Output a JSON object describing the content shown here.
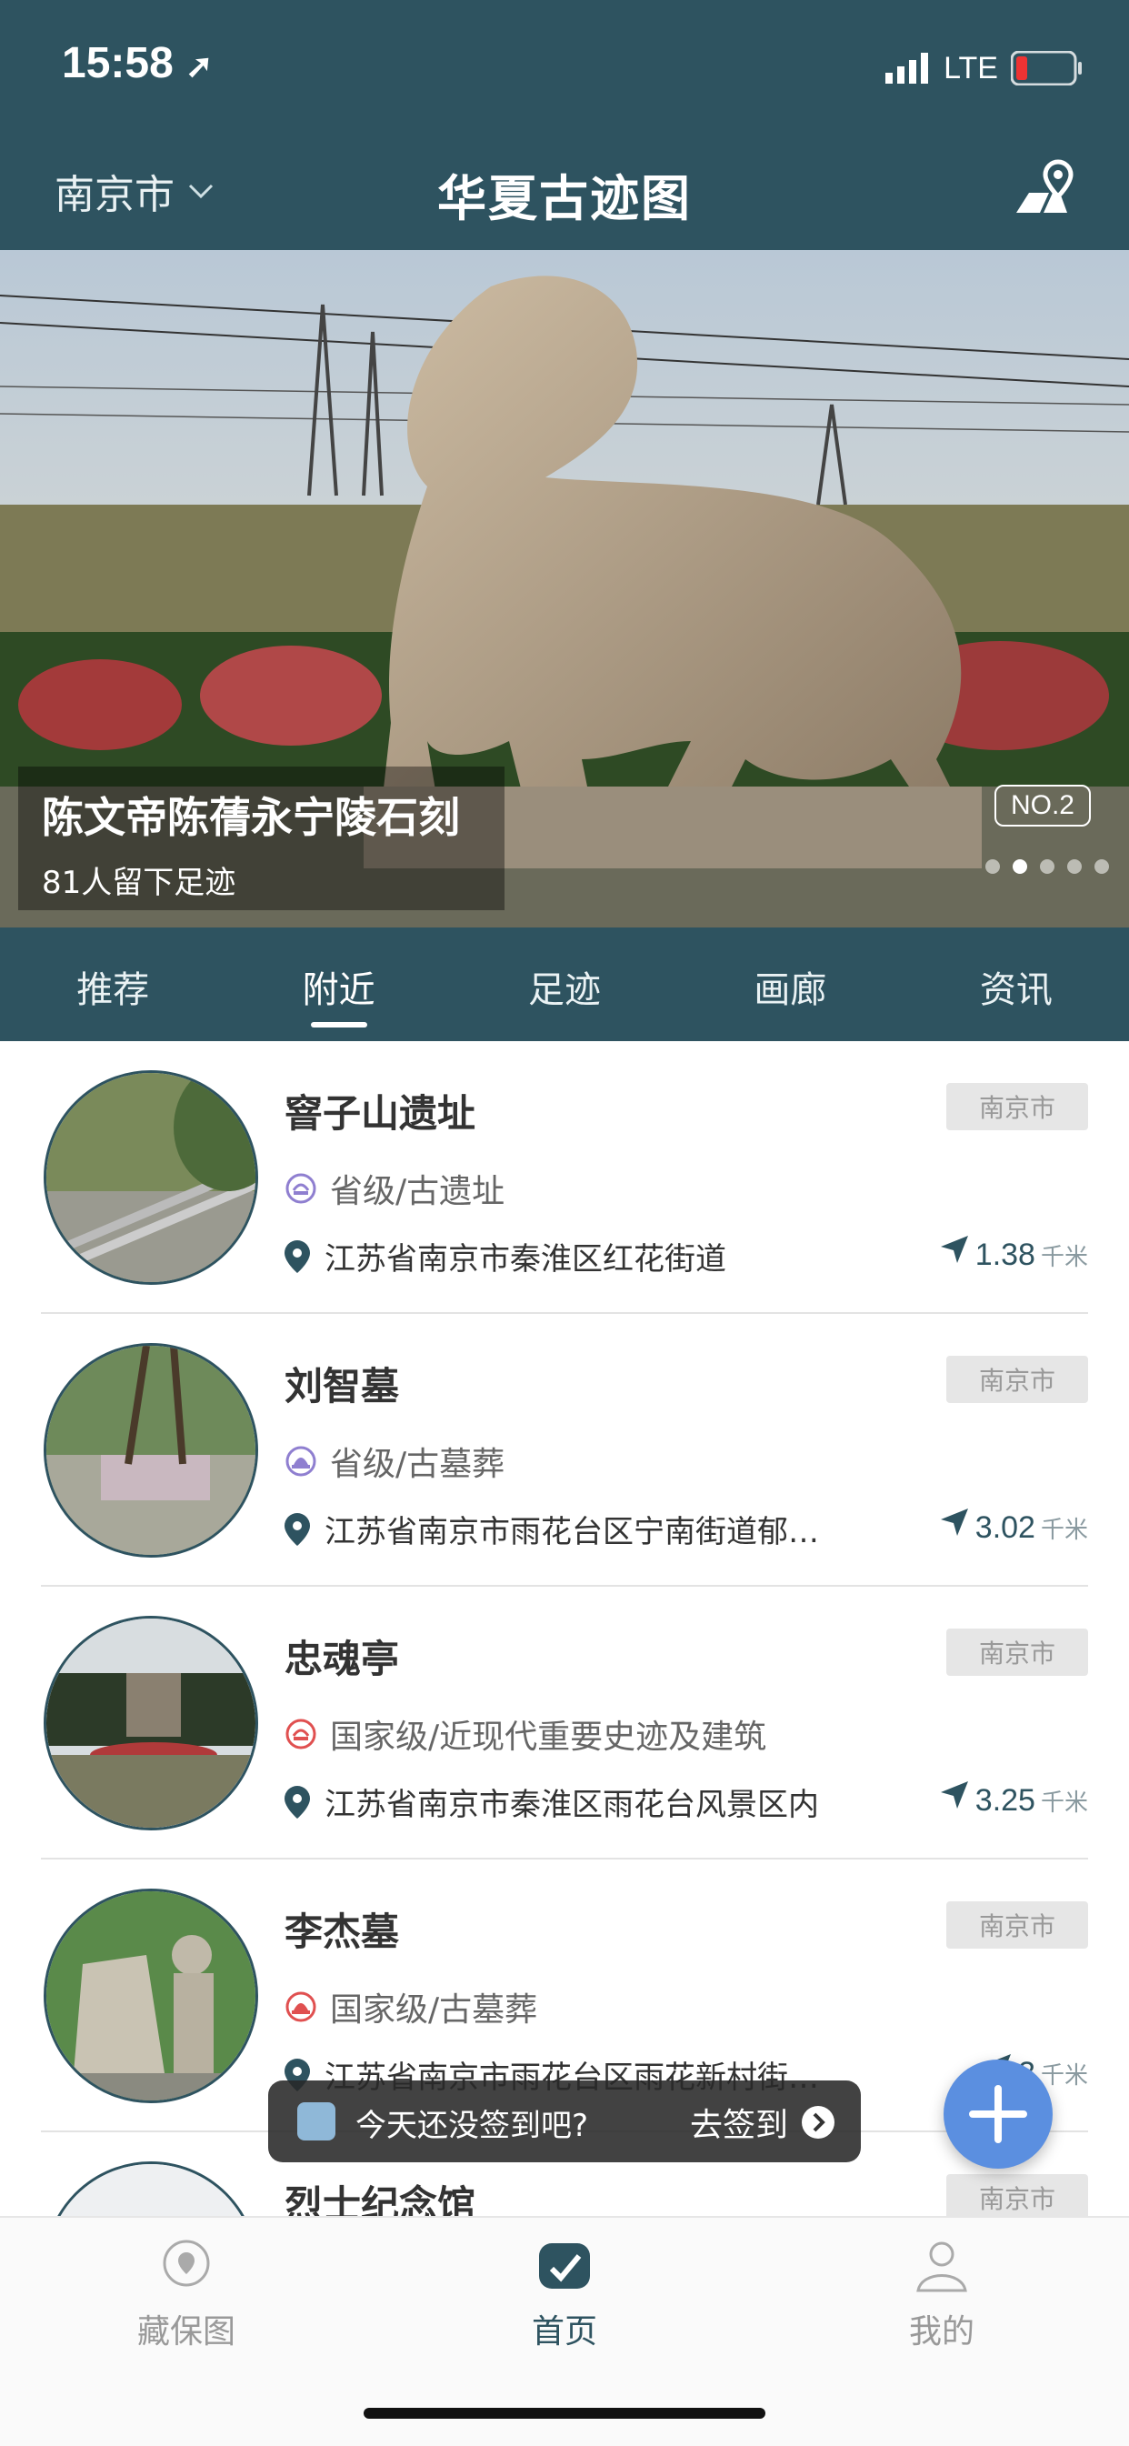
{
  "status": {
    "time": "15:58",
    "network": "LTE",
    "battery": "low"
  },
  "header": {
    "city": "南京市",
    "title": "华夏古迹图"
  },
  "banner": {
    "title": "陈文帝陈蒨永宁陵石刻",
    "subtitle": "81人留下足迹",
    "badge": "NO.2",
    "slides": 5,
    "active_slide": 2
  },
  "tabs": [
    {
      "label": "推荐",
      "active": false
    },
    {
      "label": "附近",
      "active": true
    },
    {
      "label": "足迹",
      "active": false
    },
    {
      "label": "画廊",
      "active": false
    },
    {
      "label": "资讯",
      "active": false
    }
  ],
  "sites": [
    {
      "name": "窨子山遗址",
      "city": "南京市",
      "level": "省级/古遗址",
      "level_color": "#8f7fd0",
      "address": "江苏省南京市秦淮区红花街道",
      "distance": "1.38",
      "unit": "千米"
    },
    {
      "name": "刘智墓",
      "city": "南京市",
      "level": "省级/古墓葬",
      "level_color": "#8f7fd0",
      "address": "江苏省南京市雨花台区宁南街道郁…",
      "distance": "3.02",
      "unit": "千米"
    },
    {
      "name": "忠魂亭",
      "city": "南京市",
      "level": "国家级/近现代重要史迹及建筑",
      "level_color": "#e05050",
      "address": "江苏省南京市秦淮区雨花台风景区内",
      "distance": "3.25",
      "unit": "千米"
    },
    {
      "name": "李杰墓",
      "city": "南京市",
      "level": "国家级/古墓葬",
      "level_color": "#e05050",
      "address": "江苏省南京市雨花台区雨花新村街…",
      "distance": "3",
      "unit": "千米"
    },
    {
      "name": "烈士纪念馆",
      "city": "南京市",
      "level": "",
      "level_color": "#8f7fd0",
      "address": "",
      "distance": "",
      "unit": ""
    }
  ],
  "toast": {
    "message": "今天还没签到吧?",
    "action": "去签到"
  },
  "bottom_nav": [
    {
      "label": "藏保图",
      "active": false
    },
    {
      "label": "首页",
      "active": true
    },
    {
      "label": "我的",
      "active": false
    }
  ],
  "colors": {
    "primary": "#2e5360",
    "fab": "#5b8fe0"
  }
}
